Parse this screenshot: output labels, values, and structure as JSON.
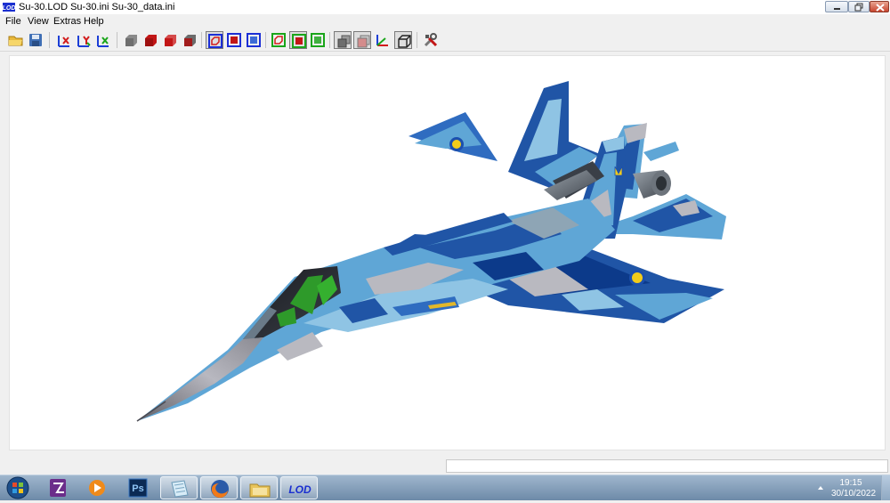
{
  "window": {
    "title": "Su-30.LOD  Su-30.ini  Su-30_data.ini",
    "app_icon": "lod-app-icon",
    "controls": [
      "minimize-icon",
      "maximize-icon",
      "close-icon"
    ]
  },
  "menu": {
    "file": "File",
    "view": "View",
    "extras": "Extras",
    "help": "Help"
  },
  "toolbar": {
    "groups": [
      [
        "open-folder-icon",
        "save-disk-icon"
      ],
      [
        "rotate-x-icon",
        "rotate-y-icon",
        "rotate-z-icon"
      ],
      [
        "shade-grey-icon",
        "shade-red-icon",
        "shade-red-light-icon",
        "shade-dark-icon"
      ],
      [
        "bbox-red-icon",
        "bbox-red-filled-icon",
        "bbox-blue-icon"
      ],
      [
        "bbox-green-outline-icon",
        "bbox-green-filled-icon",
        "bbox-green-icon"
      ],
      [
        "layers-icon",
        "render-mode-icon",
        "axes-icon",
        "wireframe-box-icon"
      ],
      [
        "tools-icon"
      ]
    ]
  },
  "viewport": {
    "content": "su30-aircraft-model",
    "background": "#ffffff",
    "camo_colors": [
      "#5fa6d6",
      "#8fc4e4",
      "#2055a6",
      "#0c3a8a",
      "#b9b9c0",
      "#8ea5b5"
    ],
    "roundel_colors": [
      "#f2cc1a",
      "#1b4fae"
    ]
  },
  "status": {
    "text": ""
  },
  "taskbar": {
    "start_icon": "windows-start-orb-icon",
    "pinned": [
      "pdf-reader-icon",
      "media-player-icon",
      "photoshop-icon",
      "notepad-icon",
      "firefox-icon",
      "file-explorer-icon",
      "lod-app-icon"
    ],
    "photoshop_label": "Ps",
    "lod_label": "LOD",
    "tray_arrow_icon": "chevron-up-icon",
    "clock": {
      "time": "19:15",
      "date": "30/10/2022"
    }
  },
  "colors": {
    "titlebar": "#ffffff",
    "chrome": "#f0f0f0",
    "taskbar_top": "#9fb6cd",
    "taskbar_bottom": "#6d8aa8",
    "close_red": "#c7452f"
  }
}
